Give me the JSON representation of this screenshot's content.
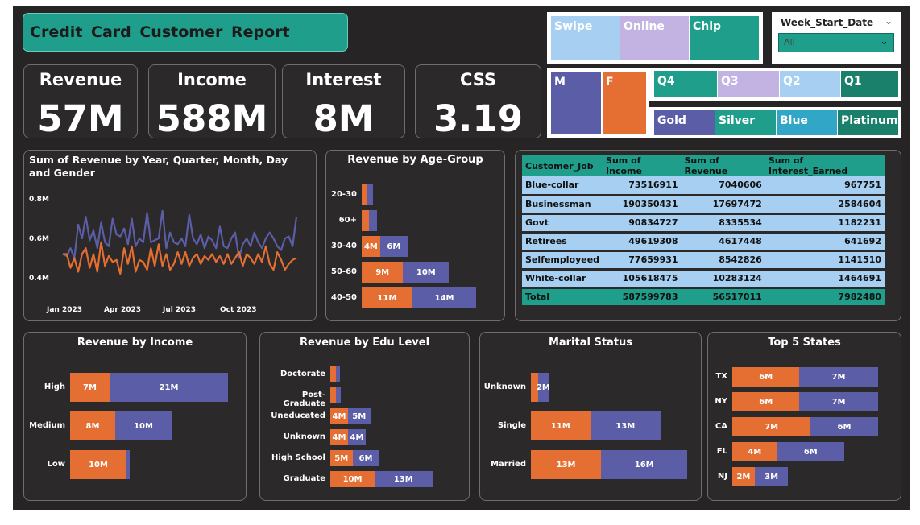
{
  "report_title": "Credit  Card  Customer  Report",
  "kpis": [
    {
      "label": "Revenue",
      "value": "57M"
    },
    {
      "label": "Income",
      "value": "588M"
    },
    {
      "label": "Interest",
      "value": "8M"
    },
    {
      "label": "CSS",
      "value": "3.19"
    }
  ],
  "colors": {
    "female": "#e56f33",
    "male": "#5b5ea6",
    "teal": "#1f9e8c"
  },
  "slicers": {
    "transaction_type": [
      "Swipe",
      "Online",
      "Chip"
    ],
    "week_start_date": {
      "label": "Week_Start_Date",
      "value": "All"
    },
    "gender": [
      "M",
      "F"
    ],
    "quarter": [
      "Q4",
      "Q3",
      "Q2",
      "Q1"
    ],
    "card_category": [
      "Gold",
      "Silver",
      "Blue",
      "Platinum"
    ]
  },
  "line_chart": {
    "title": "Sum of Revenue by Year, Quarter, Month, Day and Gender",
    "y_ticks": [
      "0.8M",
      "0.6M",
      "0.4M"
    ],
    "x_ticks": [
      "Jan 2023",
      "Apr 2023",
      "Jul 2023",
      "Oct 2023"
    ],
    "ylim": [
      0.35,
      0.85
    ],
    "series": [
      {
        "values": [
          0.52,
          0.51,
          0.55,
          0.5,
          0.67,
          0.6,
          0.71,
          0.59,
          0.64,
          0.55,
          0.68,
          0.58,
          0.56,
          0.7,
          0.62,
          0.61,
          0.65,
          0.57,
          0.7,
          0.56,
          0.6,
          0.58,
          0.73,
          0.58,
          0.59,
          0.6,
          0.74,
          0.55,
          0.63,
          0.58,
          0.57,
          0.6,
          0.56,
          0.72,
          0.6,
          0.57,
          0.62,
          0.55,
          0.61,
          0.59,
          0.55,
          0.66,
          0.56,
          0.55,
          0.6,
          0.63,
          0.5,
          0.57,
          0.6,
          0.56,
          0.63,
          0.58,
          0.55,
          0.6,
          0.63,
          0.6,
          0.56,
          0.54,
          0.6,
          0.61,
          0.56,
          0.71
        ]
      },
      {
        "values": [
          0.52,
          0.52,
          0.45,
          0.5,
          0.43,
          0.52,
          0.55,
          0.45,
          0.52,
          0.43,
          0.58,
          0.46,
          0.51,
          0.48,
          0.49,
          0.42,
          0.55,
          0.47,
          0.56,
          0.43,
          0.49,
          0.48,
          0.44,
          0.55,
          0.46,
          0.57,
          0.46,
          0.52,
          0.44,
          0.47,
          0.53,
          0.47,
          0.53,
          0.46,
          0.5,
          0.52,
          0.47,
          0.51,
          0.49,
          0.52,
          0.48,
          0.51,
          0.47,
          0.52,
          0.47,
          0.5,
          0.53,
          0.46,
          0.52,
          0.5,
          0.47,
          0.52,
          0.48,
          0.56,
          0.47,
          0.44,
          0.53,
          0.49,
          0.44,
          0.47,
          0.49,
          0.5
        ]
      }
    ]
  },
  "age_chart": {
    "title": "Revenue by Age-Group",
    "rows": [
      {
        "cat": "20-30",
        "f": 1.2,
        "m": 1.2,
        "f_label": "",
        "m_label": ""
      },
      {
        "cat": "60+",
        "f": 1.5,
        "m": 1.8,
        "f_label": "",
        "m_label": ""
      },
      {
        "cat": "30-40",
        "f": 4,
        "m": 6,
        "f_label": "4M",
        "m_label": "6M"
      },
      {
        "cat": "50-60",
        "f": 9,
        "m": 10,
        "f_label": "9M",
        "m_label": "10M"
      },
      {
        "cat": "40-50",
        "f": 11,
        "m": 14,
        "f_label": "11M",
        "m_label": "14M"
      }
    ]
  },
  "jobs_table": {
    "headers": [
      "Customer_Job",
      "Sum of Income",
      "Sum of Revenue",
      "Sum of Interest_Earned"
    ],
    "rows": [
      [
        "Blue-collar",
        "73516911",
        "7040606",
        "967751"
      ],
      [
        "Businessman",
        "190350431",
        "17697472",
        "2584604"
      ],
      [
        "Govt",
        "90834727",
        "8335534",
        "1182231"
      ],
      [
        "Retirees",
        "49619308",
        "4617448",
        "641692"
      ],
      [
        "Selfemployeed",
        "77659931",
        "8542826",
        "1141510"
      ],
      [
        "White-collar",
        "105618475",
        "10283124",
        "1464691"
      ]
    ],
    "total": [
      "Total",
      "587599783",
      "56517011",
      "7982480"
    ]
  },
  "income_chart": {
    "title": "Revenue by Income",
    "rows": [
      {
        "cat": "High",
        "f": 7,
        "m": 21,
        "f_label": "7M",
        "m_label": "21M"
      },
      {
        "cat": "Medium",
        "f": 8,
        "m": 10,
        "f_label": "8M",
        "m_label": "10M"
      },
      {
        "cat": "Low",
        "f": 10,
        "m": 0.6,
        "f_label": "10M",
        "m_label": ""
      }
    ]
  },
  "edu_chart": {
    "title": "Revenue by Edu Level",
    "rows": [
      {
        "cat": "Doctorate",
        "f": 1.2,
        "m": 1.0,
        "f_label": "",
        "m_label": ""
      },
      {
        "cat": "Post-Graduate",
        "f": 1.3,
        "m": 1.0,
        "f_label": "",
        "m_label": ""
      },
      {
        "cat": "Uneducated",
        "f": 4,
        "m": 5,
        "f_label": "4M",
        "m_label": "5M"
      },
      {
        "cat": "Unknown",
        "f": 4,
        "m": 4,
        "f_label": "4M",
        "m_label": "4M"
      },
      {
        "cat": "High School",
        "f": 5,
        "m": 6,
        "f_label": "5M",
        "m_label": "6M"
      },
      {
        "cat": "Graduate",
        "f": 10,
        "m": 13,
        "f_label": "10M",
        "m_label": "13M"
      }
    ]
  },
  "marital_chart": {
    "title": "Marital Status",
    "rows": [
      {
        "cat": "Unknown",
        "f": 1.3,
        "m": 2,
        "f_label": "",
        "m_label": "2M"
      },
      {
        "cat": "Single",
        "f": 11,
        "m": 13,
        "f_label": "11M",
        "m_label": "13M"
      },
      {
        "cat": "Married",
        "f": 13,
        "m": 16,
        "f_label": "13M",
        "m_label": "16M"
      }
    ]
  },
  "states_chart": {
    "title": "Top 5 States",
    "rows": [
      {
        "cat": "TX",
        "f": 6,
        "m": 7,
        "f_label": "6M",
        "m_label": "7M"
      },
      {
        "cat": "NY",
        "f": 6,
        "m": 7,
        "f_label": "6M",
        "m_label": "7M"
      },
      {
        "cat": "CA",
        "f": 7,
        "m": 6,
        "f_label": "7M",
        "m_label": "6M"
      },
      {
        "cat": "FL",
        "f": 4,
        "m": 6,
        "f_label": "4M",
        "m_label": "6M"
      },
      {
        "cat": "NJ",
        "f": 2,
        "m": 3,
        "f_label": "2M",
        "m_label": "3M"
      }
    ]
  }
}
